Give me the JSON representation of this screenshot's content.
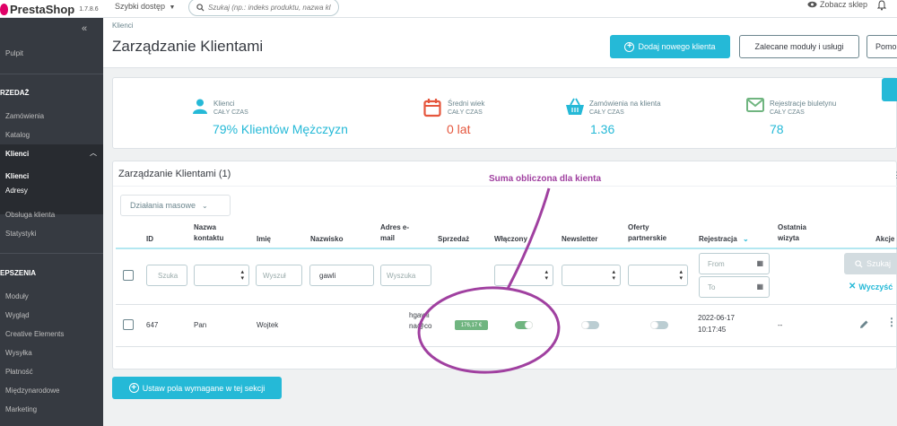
{
  "topbar": {
    "logo_text": "PrestaShop",
    "version": "1.7.8.6",
    "quick_access": "Szybki dostęp",
    "search_placeholder": "Szukaj (np.: indeks produktu, nazwa kl",
    "view_shop": "Zobacz sklep"
  },
  "sidebar": {
    "pulpit": "Pulpit",
    "sec_sales": "RZEDAŻ",
    "orders": "Zamówienia",
    "catalog": "Katalog",
    "customers": "Klienci",
    "sub_customers": "Klienci",
    "sub_addresses": "Adresy",
    "support": "Obsługa klienta",
    "stats": "Statystyki",
    "sec_improve": "EPSZENIA",
    "modules": "Moduły",
    "design": "Wygląd",
    "creative": "Creative Elements",
    "shipping": "Wysyłka",
    "payment": "Płatność",
    "international": "Międzynarodowe",
    "marketing": "Marketing"
  },
  "header": {
    "breadcrumb": "Klienci",
    "title": "Zarządzanie Klientami",
    "add_btn": "Dodaj nowego klienta",
    "recommended_btn": "Zalecane moduły i usługi",
    "help_btn": "Pomo"
  },
  "kpi": [
    {
      "label": "Klienci",
      "sub": "CAŁY CZAS",
      "value": "79% Klientów Mężczyzn",
      "color": "#25b9d7"
    },
    {
      "label": "Średni wiek",
      "sub": "CAŁY CZAS",
      "value": "0 lat",
      "color": "#e5563d"
    },
    {
      "label": "Zamówienia na klienta",
      "sub": "CAŁY CZAS",
      "value": "1.36",
      "color": "#25b9d7"
    },
    {
      "label": "Rejestracje biuletynu",
      "sub": "CAŁY CZAS",
      "value": "78",
      "color": "#25b9d7"
    }
  ],
  "panel": {
    "title": "Zarządzanie Klientami (1)",
    "bulk_actions": "Działania masowe",
    "columns": {
      "id": "ID",
      "title1": "Nazwa",
      "title2": "kontaktu",
      "firstname": "Imię",
      "lastname": "Nazwisko",
      "email1": "Adres e-",
      "email2": "mail",
      "sales": "Sprzedaż",
      "enabled": "Włączony",
      "newsletter": "Newsletter",
      "optin1": "Oferty",
      "optin2": "partnerskie",
      "registration": "Rejestracja",
      "lastvisit1": "Ostatnia",
      "lastvisit2": "wizyta",
      "actions": "Akcje"
    },
    "filters": {
      "id_placeholder": "Szuka",
      "firstname_placeholder": "Wyszuł",
      "lastname_value": "gawli",
      "email_placeholder": "Wyszuka",
      "date_from": "From",
      "date_to": "To",
      "search_btn": "Szukaj",
      "clear_btn": "Wyczyść"
    },
    "row": {
      "id": "647",
      "title": "Pan",
      "firstname": "Wojtek",
      "lastname": "",
      "email1": "hgawli",
      "email2": "na@co",
      "sales": "176,17 €",
      "enabled": true,
      "newsletter": false,
      "optin": false,
      "registration1": "2022-06-17",
      "registration2": "10:17:45",
      "lastvisit": "--"
    }
  },
  "footer_btn": "Ustaw pola wymagane w tej sekcji",
  "annotation": {
    "text": "Suma obliczona dla kienta",
    "color": "#a040a0"
  }
}
